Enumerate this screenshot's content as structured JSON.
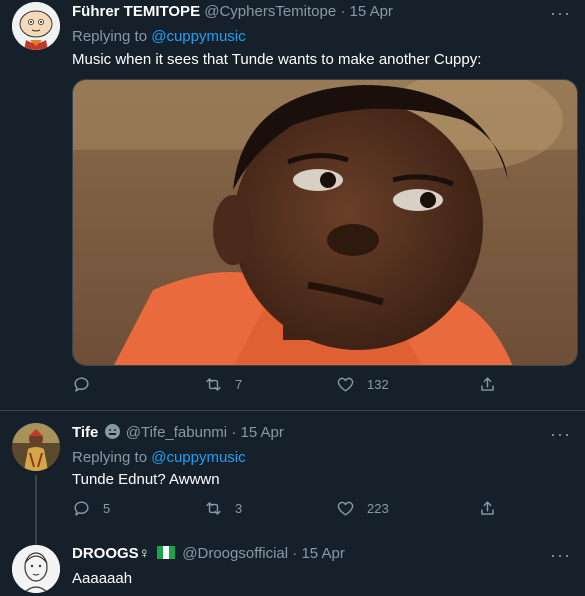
{
  "tweets": [
    {
      "display_name": "Führer TEMITOPE",
      "handle": "@CyphersTemitope",
      "dot": "·",
      "time": "15 Apr",
      "replying_prefix": "Replying to",
      "replying_to": "@cuppymusic",
      "text": "Music when it sees that Tunde wants to make another Cuppy:",
      "retweets": "7",
      "likes": "132"
    },
    {
      "display_name": "Tife",
      "handle": "@Tife_fabunmi",
      "dot": "·",
      "time": "15 Apr",
      "replying_prefix": "Replying to",
      "replying_to": "@cuppymusic",
      "text": "Tunde Ednut? Awwwn",
      "replies": "5",
      "retweets": "3",
      "likes": "223"
    },
    {
      "display_name": "DROOGS♀",
      "handle": "@Droogsofficial",
      "dot": "·",
      "time": "15 Apr",
      "text": "Aaaaaah"
    }
  ],
  "ui": {
    "more": "···"
  },
  "colors": {
    "background": "#15202b",
    "link": "#1da1f2",
    "muted": "#8899a6",
    "divider": "#38444d"
  },
  "icons": [
    "reply-icon",
    "retweet-icon",
    "like-icon",
    "share-icon",
    "more-icon",
    "emoji-badge-icon",
    "nigeria-flag-icon"
  ]
}
